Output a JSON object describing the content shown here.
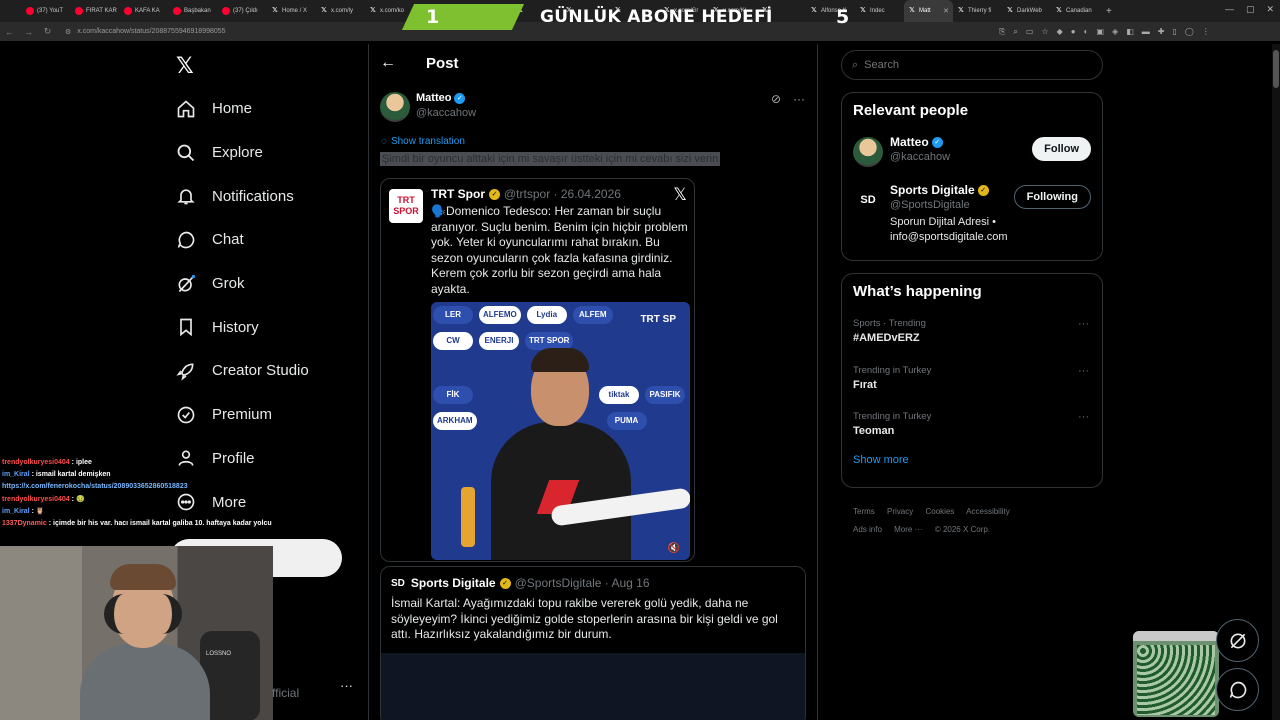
{
  "browser": {
    "tabs": [
      {
        "label": "(37) YouT",
        "icon": "youtube-icon",
        "active": false
      },
      {
        "label": "FIRAT KAR",
        "icon": "youtube-icon",
        "active": false
      },
      {
        "label": "KAFA KA",
        "icon": "youtube-icon",
        "active": false
      },
      {
        "label": "Başbakan",
        "icon": "youtube-icon",
        "active": false
      },
      {
        "label": "(37) Çıldı",
        "icon": "youtube-icon",
        "active": false
      },
      {
        "label": "Home / X",
        "icon": "x-icon",
        "active": false
      },
      {
        "label": "x.com/ly",
        "icon": "x-icon",
        "active": false
      },
      {
        "label": "x.com/ko",
        "icon": "x-icon",
        "active": false
      },
      {
        "label": "",
        "icon": "x-icon",
        "active": false
      },
      {
        "label": "",
        "icon": "x-icon",
        "active": false
      },
      {
        "label": "",
        "icon": "x-icon",
        "active": false
      },
      {
        "label": "",
        "icon": "x-icon",
        "active": false
      },
      {
        "label": "",
        "icon": "x-icon",
        "active": false
      },
      {
        "label": "x.com/Gr",
        "icon": "x-icon",
        "active": false
      },
      {
        "label": "x.com/Kl",
        "icon": "x-icon",
        "active": false
      },
      {
        "label": "",
        "icon": "x-icon",
        "active": false
      },
      {
        "label": "Alfonso K",
        "icon": "x-icon",
        "active": false
      },
      {
        "label": "Indec",
        "icon": "x-icon",
        "active": false
      },
      {
        "label": "Matt",
        "icon": "x-icon",
        "active": true
      },
      {
        "label": "Thierry fi",
        "icon": "x-icon",
        "active": false
      },
      {
        "label": "DarkWeb",
        "icon": "x-icon",
        "active": false
      },
      {
        "label": "Canadian",
        "icon": "x-icon",
        "active": false
      }
    ],
    "url": "x.com/kaccahow/status/2088755946918998055"
  },
  "goal_banner": {
    "current": "1",
    "title": "GÜNLÜK ABONE HEDEFİ",
    "target": "5"
  },
  "nav": {
    "items": [
      {
        "label": "Home",
        "icon": "home-icon"
      },
      {
        "label": "Explore",
        "icon": "search-icon"
      },
      {
        "label": "Notifications",
        "icon": "bell-icon"
      },
      {
        "label": "Chat",
        "icon": "chat-bubble-icon"
      },
      {
        "label": "Grok",
        "icon": "grok-icon"
      },
      {
        "label": "History",
        "icon": "bookmark-icon"
      },
      {
        "label": "Creator Studio",
        "icon": "rocket-icon"
      },
      {
        "label": "Premium",
        "icon": "verified-badge-icon"
      },
      {
        "label": "Profile",
        "icon": "person-icon"
      },
      {
        "label": "More",
        "icon": "more-circle-icon"
      }
    ]
  },
  "post": {
    "header_title": "Post",
    "author_name": "Matteo",
    "author_handle": "@kaccahow",
    "show_translation": "Show translation",
    "text": "Şimdi bir oyuncu alttaki için mi savaşır üstteki için mi cevabı sizi verin",
    "quote": {
      "name": "TRT Spor",
      "handle_date": "@trtspor · 26.04.2026",
      "logo_top": "TRT",
      "logo_bottom": "SPOR",
      "body": "🗣️Domenico Tedesco: Her zaman bir suçlu aranıyor. Suçlu benim. Benim için hiçbir problem yok. Yeter ki oyuncularımı rahat bırakın. Bu sezon oyuncuların çok fazla kafasına girdiniz. Kerem çok zorlu bir sezon geçirdi ama hala ayakta.",
      "sponsors_row1": [
        "LER",
        "ALFEMO",
        "Lydia",
        "ALFEM"
      ],
      "sponsors_row2": [
        "CW",
        "ENERJI",
        "TRT SPOR"
      ],
      "sponsors_row3": [
        "FİK",
        "tiktak",
        "PASIFIK"
      ],
      "sponsors_row4": [
        "ARKHAM",
        "PUMA"
      ],
      "watermark": "TRT SP"
    }
  },
  "second_post": {
    "logo": "SD",
    "name": "Sports Digitale",
    "handle_date": "@SportsDigitale · Aug 16",
    "body": "İsmail Kartal: Ayağımızdaki topu rakibe vererek golü yedik, daha ne söyleyeyim? İkinci yediğimiz golde stoperlerin arasına bir kişi geldi ve gol attı. Hazırlıksız yakalandığımız bir durum."
  },
  "search": {
    "placeholder": "Search"
  },
  "relevant_people": {
    "title": "Relevant people",
    "people": [
      {
        "name": "Matteo",
        "handle": "@kaccahow",
        "button": "Follow",
        "bio": ""
      },
      {
        "name": "Sports Digitale",
        "handle": "@SportsDigitale",
        "button": "Following",
        "bio": "Sporun Dijital Adresi • info@sportsdigitale.com"
      }
    ]
  },
  "whats_happening": {
    "title": "What’s happening",
    "trends": [
      {
        "meta": "Sports · Trending",
        "tag": "#AMEDvERZ"
      },
      {
        "meta": "Trending in Turkey",
        "tag": "Fırat"
      },
      {
        "meta": "Trending in Turkey",
        "tag": "Teoman"
      }
    ],
    "show_more": "Show more"
  },
  "footer": {
    "links": [
      "Terms",
      "Privacy",
      "Cookies",
      "Accessibility",
      "Ads info",
      "More ···",
      "© 2026 X Corp."
    ]
  },
  "stream_chat": [
    {
      "user": "trendyolkuryesi0404",
      "msg": "iplee",
      "user_class": "u1"
    },
    {
      "user": "im_Kiral",
      "msg": "ismail kartal demişken",
      "user_class": "u2"
    },
    {
      "user": "",
      "msg": "https://x.com/fenerokocha/status/2089033652860518823",
      "user_class": "link"
    },
    {
      "user": "trendyolkuryesi0404",
      "msg": "🤢",
      "user_class": "u1"
    },
    {
      "user": "im_Kiral",
      "msg": "🦉",
      "user_class": "u2"
    },
    {
      "user": "1337Dynamic",
      "msg": "içimde bir his var. hacı ismail kartal galiba 10. haftaya kadar yolcu",
      "user_class": "u3"
    }
  ],
  "webcam": {
    "chair_brand": "LOSSNO"
  },
  "overlay": {
    "official_text": "fficial"
  }
}
